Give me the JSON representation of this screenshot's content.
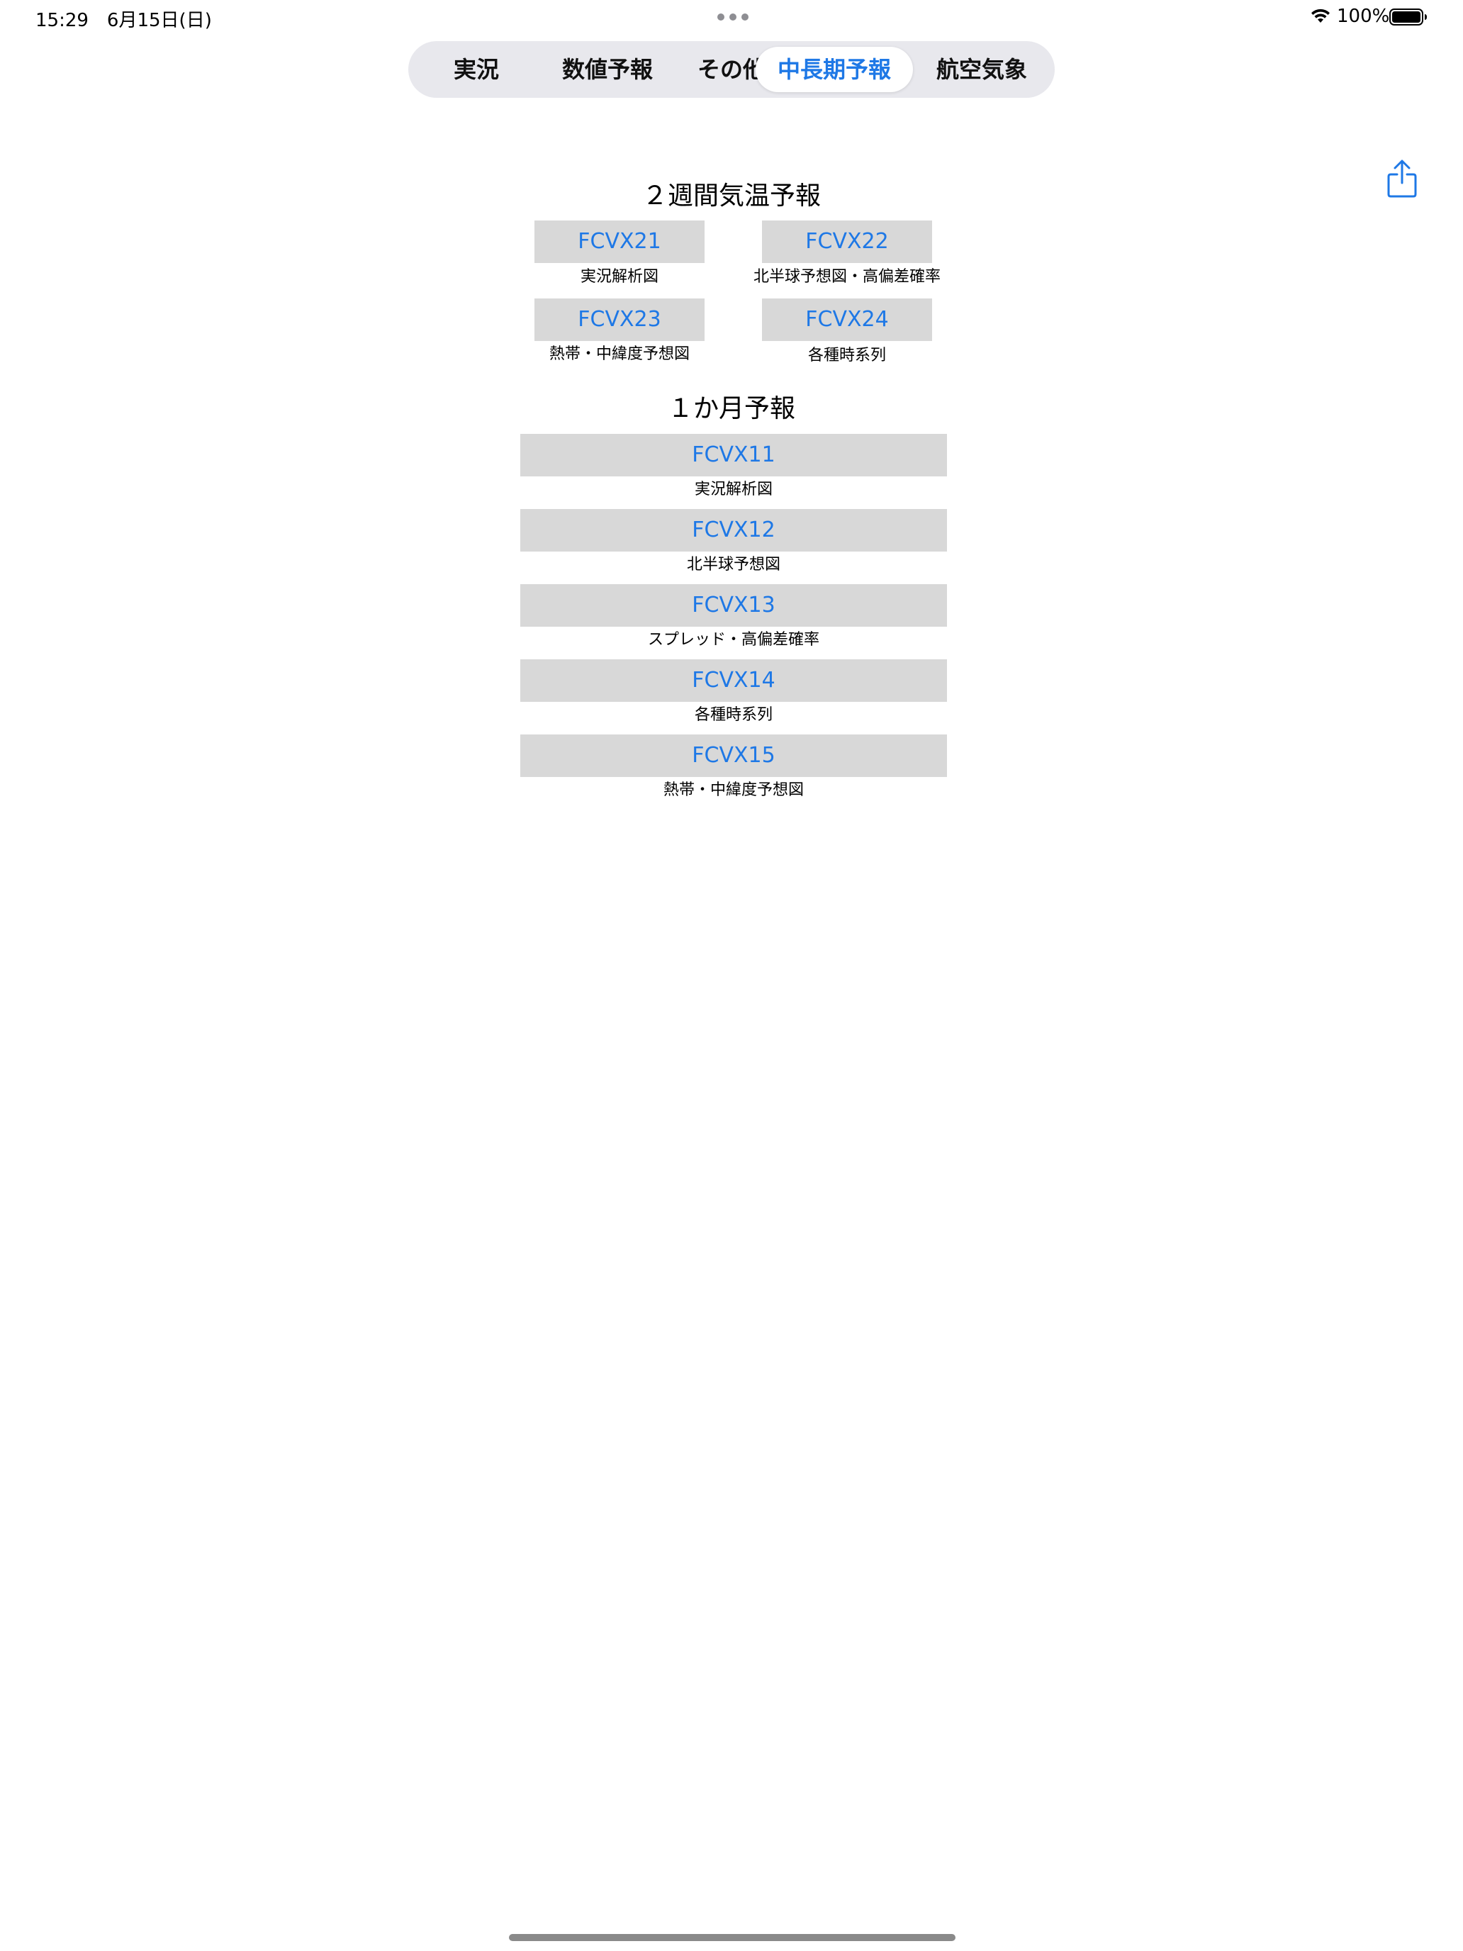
{
  "status_bar": {
    "time": "15:29　6月15日(日)",
    "battery": "100%"
  },
  "tabs": [
    {
      "label": "実況"
    },
    {
      "label": "数値予報"
    },
    {
      "label": "その他"
    },
    {
      "label": "中長期予報",
      "selected": true
    },
    {
      "label": "航空気象"
    }
  ],
  "sections": {
    "two_week": {
      "title": "２週間気温予報",
      "items": [
        {
          "code": "FCVX21",
          "caption": "実況解析図"
        },
        {
          "code": "FCVX22",
          "caption": "北半球予想図・高偏差確率"
        },
        {
          "code": "FCVX23",
          "caption": "熱帯・中緯度予想図"
        },
        {
          "code": "FCVX24",
          "caption": "各種時系列"
        }
      ]
    },
    "one_month": {
      "title": "１か月予報",
      "items": [
        {
          "code": "FCVX11",
          "caption": "実況解析図"
        },
        {
          "code": "FCVX12",
          "caption": "北半球予想図"
        },
        {
          "code": "FCVX13",
          "caption": "スプレッド・高偏差確率"
        },
        {
          "code": "FCVX14",
          "caption": "各種時系列"
        },
        {
          "code": "FCVX15",
          "caption": "熱帯・中緯度予想図"
        }
      ]
    }
  },
  "colors": {
    "accent": "#1e78e6",
    "button_bg": "#d8d8d8",
    "segment_bg": "#e8e8ed"
  },
  "icons": {
    "share": "share-icon",
    "wifi": "wifi-icon",
    "battery": "battery-icon"
  }
}
